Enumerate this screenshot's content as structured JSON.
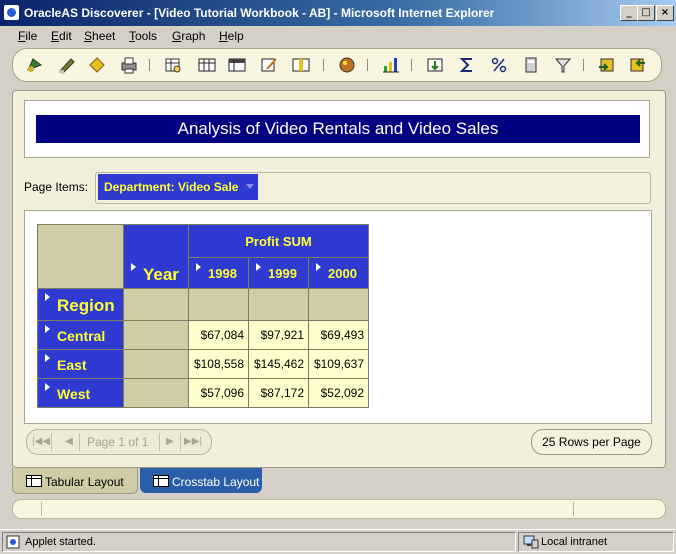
{
  "window": {
    "title": "OracleAS Discoverer - [Video Tutorial Workbook - AB] - Microsoft Internet Explorer",
    "controls": [
      "_",
      "□",
      "×"
    ]
  },
  "menu": [
    "File",
    "Edit",
    "Sheet",
    "Tools",
    "Graph",
    "Help"
  ],
  "toolbar": {
    "icons": [
      "open-icon",
      "edit-icon",
      "save-icon",
      "print-icon",
      "query-icon",
      "table-icon",
      "crosstab-icon",
      "edit-sheet-icon",
      "columns-icon",
      "palette-icon",
      "chart-icon",
      "export-icon",
      "sum-icon",
      "percent-icon",
      "calculate-icon",
      "filter-icon",
      "drill-in-icon",
      "drill-out-icon"
    ]
  },
  "report": {
    "title": "Analysis of Video Rentals and Video Sales"
  },
  "page_items": {
    "label": "Page Items:",
    "department": "Department:  Video Sale"
  },
  "crosstab": {
    "measure": "Profit SUM",
    "column_item": "Year",
    "row_item": "Region",
    "years": [
      "1998",
      "1999",
      "2000"
    ],
    "rows": [
      {
        "region": "Central",
        "values": [
          "$67,084",
          "$97,921",
          "$69,493"
        ]
      },
      {
        "region": "East",
        "values": [
          "$108,558",
          "$145,462",
          "$109,637"
        ]
      },
      {
        "region": "West",
        "values": [
          "$57,096",
          "$87,172",
          "$52,092"
        ]
      }
    ]
  },
  "pager": {
    "label": "Page 1 of 1",
    "rows_per_page": "25 Rows per Page"
  },
  "tabs": {
    "tabular": "Tabular Layout",
    "crosstab": "Crosstab Layout"
  },
  "status": {
    "text": "Applet started.",
    "zone": "Local intranet"
  },
  "colors": {
    "title_bar": "#0a246a",
    "report_title_bg": "#000080",
    "crosstab_header": "#2e3ad0",
    "header_text": "#ffff33",
    "data_cell": "#ffffcc",
    "active_tab": "#2b5ea8"
  }
}
